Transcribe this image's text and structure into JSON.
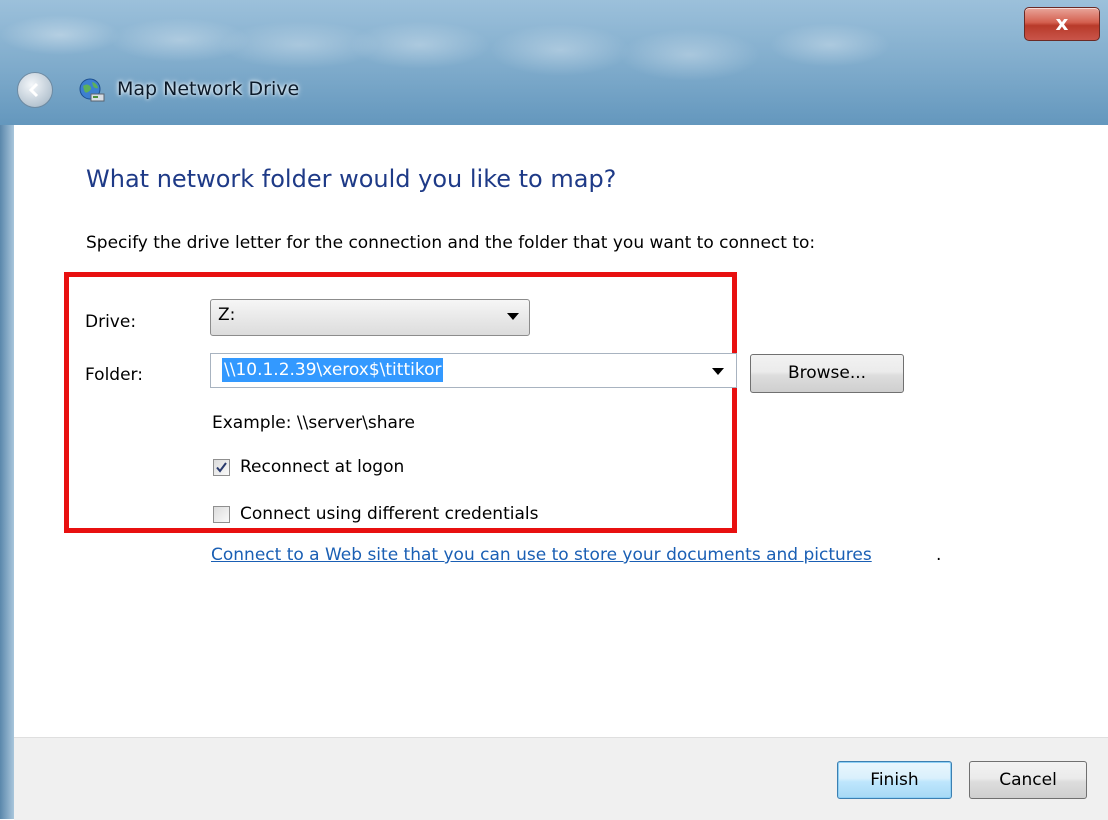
{
  "window": {
    "title": "Map Network Drive",
    "close_label": "x"
  },
  "main": {
    "heading": "What network folder would you like to map?",
    "instruction": "Specify the drive letter for the connection and the folder that you want to connect to:",
    "drive_label": "Drive:",
    "drive_value": "Z:",
    "folder_label": "Folder:",
    "folder_value": "\\\\10.1.2.39\\xerox$\\tittikor",
    "browse_label": "Browse...",
    "example_text": "Example: \\\\server\\share",
    "reconnect_label": "Reconnect at logon",
    "reconnect_checked": true,
    "credentials_label": "Connect using different credentials",
    "credentials_checked": false,
    "web_link": "Connect to a Web site that you can use to store your documents and pictures",
    "web_link_suffix": "."
  },
  "footer": {
    "finish_label": "Finish",
    "cancel_label": "Cancel"
  },
  "colors": {
    "highlight_border": "#e81010",
    "heading": "#1e3a87",
    "link": "#1a5fb4",
    "selection": "#3399ff"
  },
  "icons": [
    "back-arrow-icon",
    "network-drive-icon",
    "close-icon",
    "dropdown-arrow-icon",
    "checkmark-icon"
  ]
}
